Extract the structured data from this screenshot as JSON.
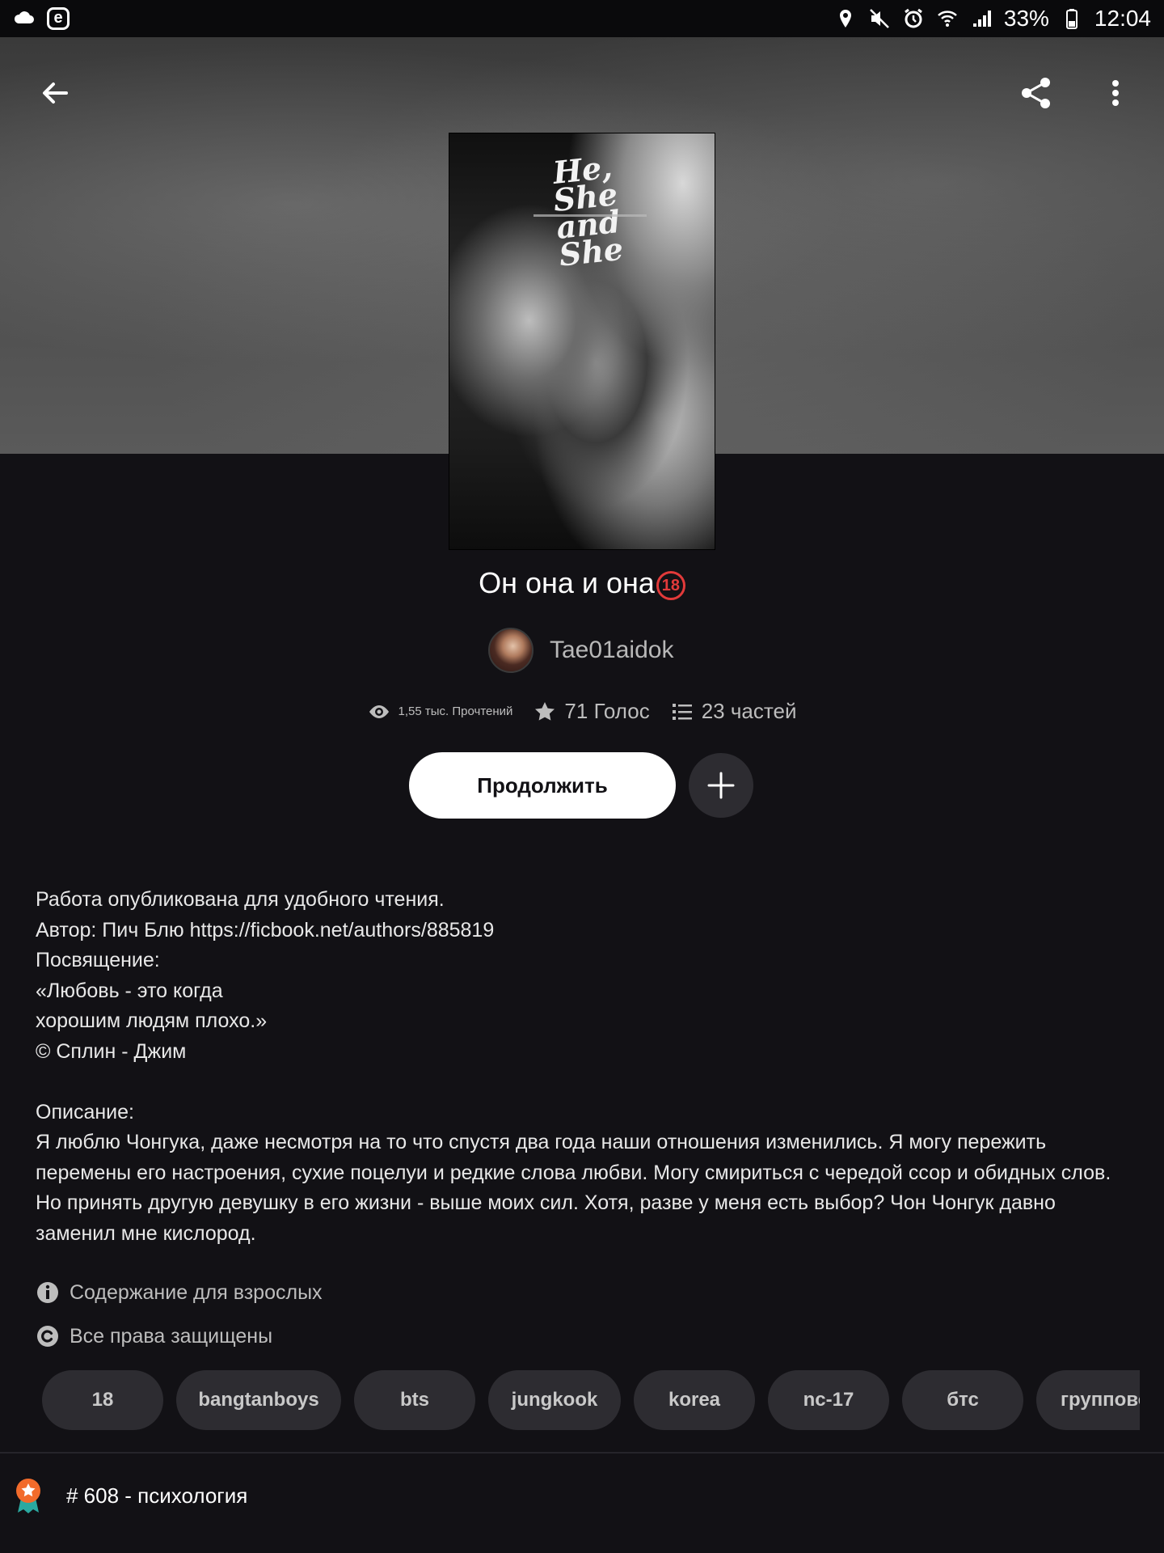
{
  "status_bar": {
    "battery": "33%",
    "time": "12:04"
  },
  "toolbar": {
    "back_icon": "arrow-left-icon",
    "share_icon": "share-icon",
    "menu_icon": "more-vertical-icon"
  },
  "cover": {
    "title": "He, She and She"
  },
  "book": {
    "title": "Он она и она",
    "age_badge": "18",
    "author": "Tae01aidok",
    "reads": "1,55 тыс. Прочтений",
    "votes": "71 Голос",
    "parts": "23 частей"
  },
  "actions": {
    "continue_label": "Продолжить"
  },
  "description": {
    "lines": [
      "Работа опубликована для удобного чтения.",
      "Автор: Пич Блю https://ficbook.net/authors/885819",
      "Посвящение:",
      "«Любовь - это когда",
      "хорошим людям плохо.»",
      "© Сплин - Джим",
      "",
      "Описание:"
    ],
    "summary": "Я люблю Чонгука, даже несмотря на то что спустя два года наши отношения изменились. Я могу пережить перемены его настроения, сухие поцелуи и редкие слова любви. Могу смириться с чередой ссор и обидных слов. Но принять другую девушку в его жизни - выше моих сил. Хотя, разве у меня есть выбор? Чон Чонгук давно заменил мне кислород."
  },
  "meta": {
    "mature": "Содержание для взрослых",
    "copyright": "Все права защищены"
  },
  "tags": [
    "18",
    "bangtanboys",
    "bts",
    "jungkook",
    "korea",
    "nc-17",
    "бтс",
    "групповой"
  ],
  "ranking": {
    "text": "# 608 - психология"
  },
  "colors": {
    "background": "#121115",
    "chip": "#2d2c31",
    "badge_red": "#e23a3a",
    "ranking_orange": "#f26b2b"
  }
}
